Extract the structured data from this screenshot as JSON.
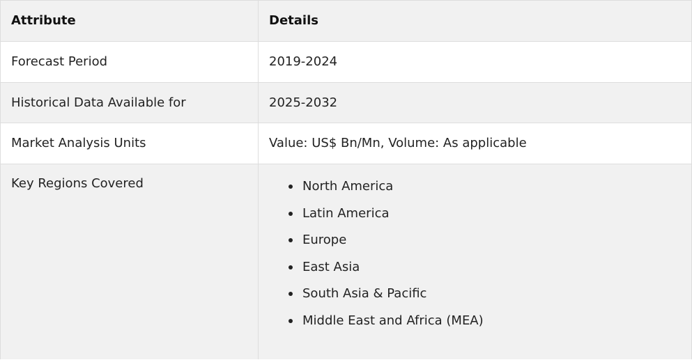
{
  "table": {
    "header": {
      "attribute": "Attribute",
      "details": "Details"
    },
    "rows": [
      {
        "attribute": "Forecast Period",
        "details": "2019-2024"
      },
      {
        "attribute": "Historical Data Available for",
        "details": "2025-2032"
      },
      {
        "attribute": "Market Analysis Units",
        "details": "Value: US$ Bn/Mn, Volume: As applicable"
      }
    ],
    "regions_row": {
      "attribute": "Key Regions Covered",
      "items": [
        "North America",
        "Latin America",
        "Europe",
        "East Asia",
        "South Asia & Pacific",
        "Middle East and Africa (MEA)"
      ]
    }
  },
  "colors": {
    "border": "#dddddd",
    "stripe": "#f1f1f1",
    "text": "#222222"
  }
}
